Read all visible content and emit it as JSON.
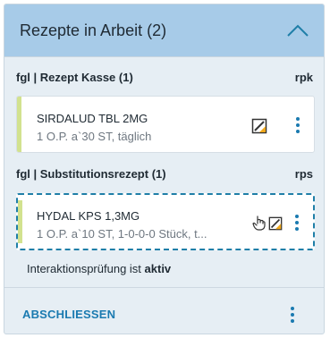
{
  "panel": {
    "title": "Rezepte in Arbeit (2)"
  },
  "groups": [
    {
      "title": "fgl | Rezept Kasse (1)",
      "code": "rpk",
      "items": [
        {
          "name": "SIRDALUD TBL 2MG",
          "detail": "1 O.P. a`30 ST, täglich"
        }
      ]
    },
    {
      "title": "fgl | Substitutionsrezept (1)",
      "code": "rps",
      "items": [
        {
          "name": "HYDAL KPS 1,3MG",
          "detail": "1 O.P. a`10 ST, 1-0-0-0 Stück, t..."
        }
      ]
    }
  ],
  "interaction": {
    "label": "Interaktionsprüfung ist ",
    "status": "aktiv"
  },
  "footer": {
    "action_label": "ABSCHLIESSEN"
  },
  "colors": {
    "header_bg": "#a7cbe8",
    "panel_bg": "#e6eef4",
    "accent": "#1a7ab0",
    "card_stripe": "#d2e28f",
    "selected_border": "#1f7fa8"
  },
  "icons": {
    "collapse": "chevron-up-icon",
    "edit": "edit-document-icon",
    "substitution": "hand-pointer-icon",
    "menu": "more-vertical-icon"
  }
}
